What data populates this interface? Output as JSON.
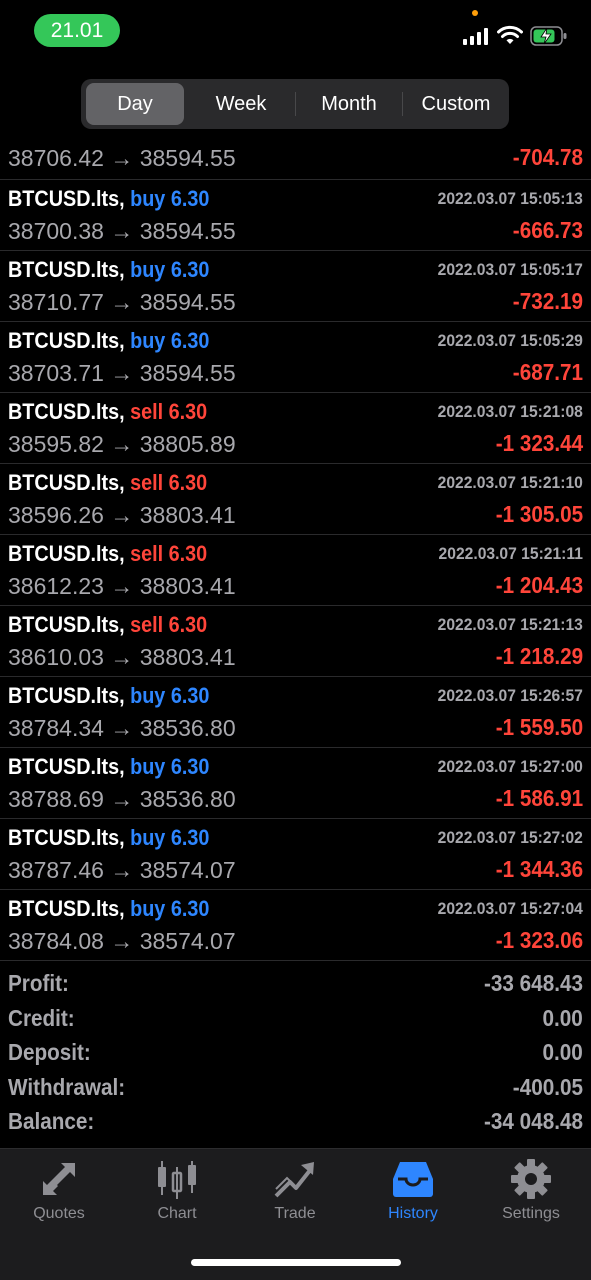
{
  "status_bar": {
    "time": "21.01"
  },
  "period_tabs": [
    "Day",
    "Week",
    "Month",
    "Custom"
  ],
  "period_active": "Day",
  "partial_trade": {
    "prices": "38706.42 → 38594.55",
    "profit": "-704.78"
  },
  "trades": [
    {
      "symbol": "BTCUSD.lts,",
      "side": "buy",
      "side_volume": "buy 6.30",
      "datetime": "2022.03.07 15:05:13",
      "prices": "38700.38 → 38594.55",
      "profit": "-666.73"
    },
    {
      "symbol": "BTCUSD.lts,",
      "side": "buy",
      "side_volume": "buy 6.30",
      "datetime": "2022.03.07 15:05:17",
      "prices": "38710.77 → 38594.55",
      "profit": "-732.19"
    },
    {
      "symbol": "BTCUSD.lts,",
      "side": "buy",
      "side_volume": "buy 6.30",
      "datetime": "2022.03.07 15:05:29",
      "prices": "38703.71 → 38594.55",
      "profit": "-687.71"
    },
    {
      "symbol": "BTCUSD.lts,",
      "side": "sell",
      "side_volume": "sell 6.30",
      "datetime": "2022.03.07 15:21:08",
      "prices": "38595.82 → 38805.89",
      "profit": "-1 323.44"
    },
    {
      "symbol": "BTCUSD.lts,",
      "side": "sell",
      "side_volume": "sell 6.30",
      "datetime": "2022.03.07 15:21:10",
      "prices": "38596.26 → 38803.41",
      "profit": "-1 305.05"
    },
    {
      "symbol": "BTCUSD.lts,",
      "side": "sell",
      "side_volume": "sell 6.30",
      "datetime": "2022.03.07 15:21:11",
      "prices": "38612.23 → 38803.41",
      "profit": "-1 204.43"
    },
    {
      "symbol": "BTCUSD.lts,",
      "side": "sell",
      "side_volume": "sell 6.30",
      "datetime": "2022.03.07 15:21:13",
      "prices": "38610.03 → 38803.41",
      "profit": "-1 218.29"
    },
    {
      "symbol": "BTCUSD.lts,",
      "side": "buy",
      "side_volume": "buy 6.30",
      "datetime": "2022.03.07 15:26:57",
      "prices": "38784.34 → 38536.80",
      "profit": "-1 559.50"
    },
    {
      "symbol": "BTCUSD.lts,",
      "side": "buy",
      "side_volume": "buy 6.30",
      "datetime": "2022.03.07 15:27:00",
      "prices": "38788.69 → 38536.80",
      "profit": "-1 586.91"
    },
    {
      "symbol": "BTCUSD.lts,",
      "side": "buy",
      "side_volume": "buy 6.30",
      "datetime": "2022.03.07 15:27:02",
      "prices": "38787.46 → 38574.07",
      "profit": "-1 344.36"
    },
    {
      "symbol": "BTCUSD.lts,",
      "side": "buy",
      "side_volume": "buy 6.30",
      "datetime": "2022.03.07 15:27:04",
      "prices": "38784.08 → 38574.07",
      "profit": "-1 323.06"
    }
  ],
  "summary": [
    {
      "label": "Profit:",
      "value": "-33 648.43"
    },
    {
      "label": "Credit:",
      "value": "0.00"
    },
    {
      "label": "Deposit:",
      "value": "0.00"
    },
    {
      "label": "Withdrawal:",
      "value": "-400.05"
    },
    {
      "label": "Balance:",
      "value": "-34 048.48"
    }
  ],
  "tab_bar": [
    {
      "label": "Quotes",
      "icon": "quotes-arrows-icon"
    },
    {
      "label": "Chart",
      "icon": "candlestick-icon"
    },
    {
      "label": "Trade",
      "icon": "trend-line-icon"
    },
    {
      "label": "History",
      "icon": "inbox-tray-icon",
      "active": true
    },
    {
      "label": "Settings",
      "icon": "gear-icon"
    }
  ],
  "colors": {
    "buy": "#2e86ff",
    "sell": "#ff453a",
    "loss": "#ff453a",
    "accent": "#2e86ff",
    "time_pill": "#34c759",
    "muted": "#a8a8ad"
  }
}
